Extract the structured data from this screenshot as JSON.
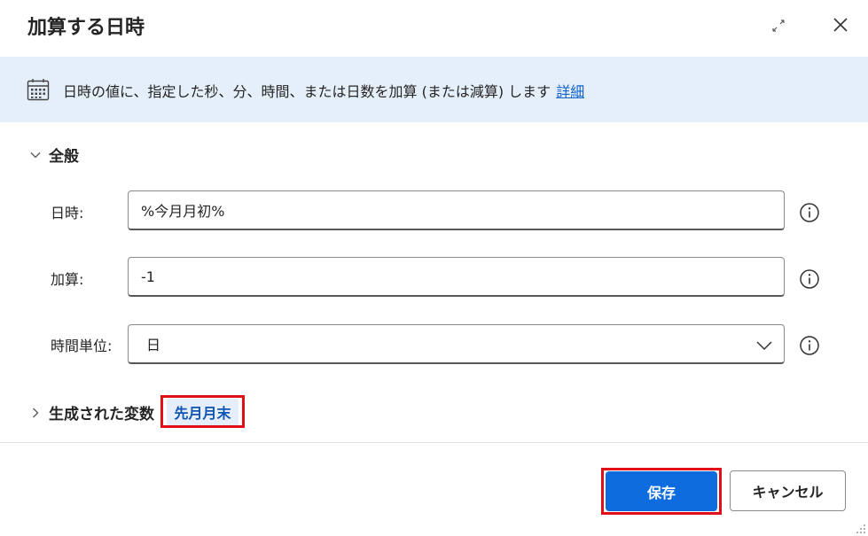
{
  "dialog": {
    "title": "加算する日時"
  },
  "header_icons": {
    "expand": "expand-icon",
    "close": "close-icon"
  },
  "banner": {
    "icon": "calendar-icon",
    "text": "日時の値に、指定した秒、分、時間、または日数を加算 (または減算) します",
    "link": "詳細"
  },
  "general": {
    "label": "全般",
    "fields": {
      "datetime": {
        "label": "日時:",
        "value": "%今月月初%"
      },
      "add": {
        "label": "加算:",
        "value": "-1"
      },
      "unit": {
        "label": "時間単位:",
        "value": "日"
      }
    }
  },
  "generated_vars": {
    "label": "生成された変数",
    "variable": "先月月末"
  },
  "footer": {
    "save_label": "保存",
    "cancel_label": "キャンセル"
  },
  "colors": {
    "banner_bg": "#e5effa",
    "primary": "#0f6cde",
    "highlight": "#e0101a",
    "link": "#0f62c9"
  }
}
